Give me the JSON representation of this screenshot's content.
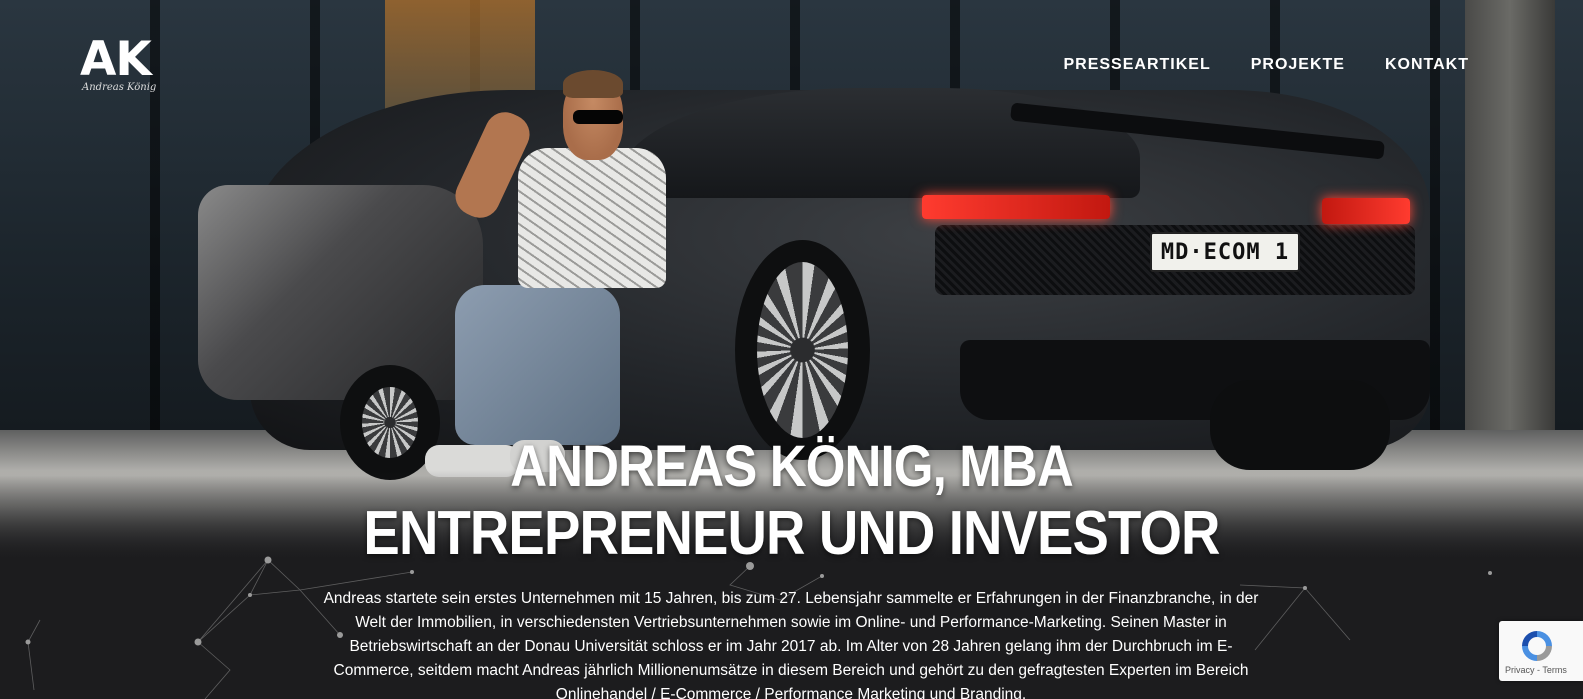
{
  "logo": {
    "mark": "AK",
    "signature": "Andreas König"
  },
  "nav": {
    "items": [
      "PRESSEARTIKEL",
      "PROJEKTE",
      "KONTAKT"
    ]
  },
  "hero": {
    "plate": "MD·ECOM 1",
    "headline_1": "ANDREAS KÖNIG, MBA",
    "headline_2": "ENTREPRENEUR UND INVESTOR"
  },
  "intro": {
    "text": "Andreas startete sein erstes Unternehmen mit 15 Jahren, bis zum 27. Lebensjahr sammelte er Erfahrungen in der Finanzbranche, in der Welt der Immobilien, in verschiedensten Vertriebsunternehmen sowie im Online- und Performance-Marketing. Seinen Master in Betriebswirtschaft an der Donau Universität schloss er im Jahr 2017 ab. Im Alter von 28 Jahren gelang ihm der Durchbruch im E-Commerce, seitdem macht Andreas jährlich Millionenumsätze in diesem Bereich und gehört zu den gefragtesten Experten im Bereich Onlinehandel / E-Commerce / Performance Marketing und Branding."
  },
  "recaptcha": {
    "links": "Privacy - Terms"
  },
  "colors": {
    "background": "#1c1c1e",
    "text": "#ffffff",
    "taillight": "#ff3b2f"
  }
}
